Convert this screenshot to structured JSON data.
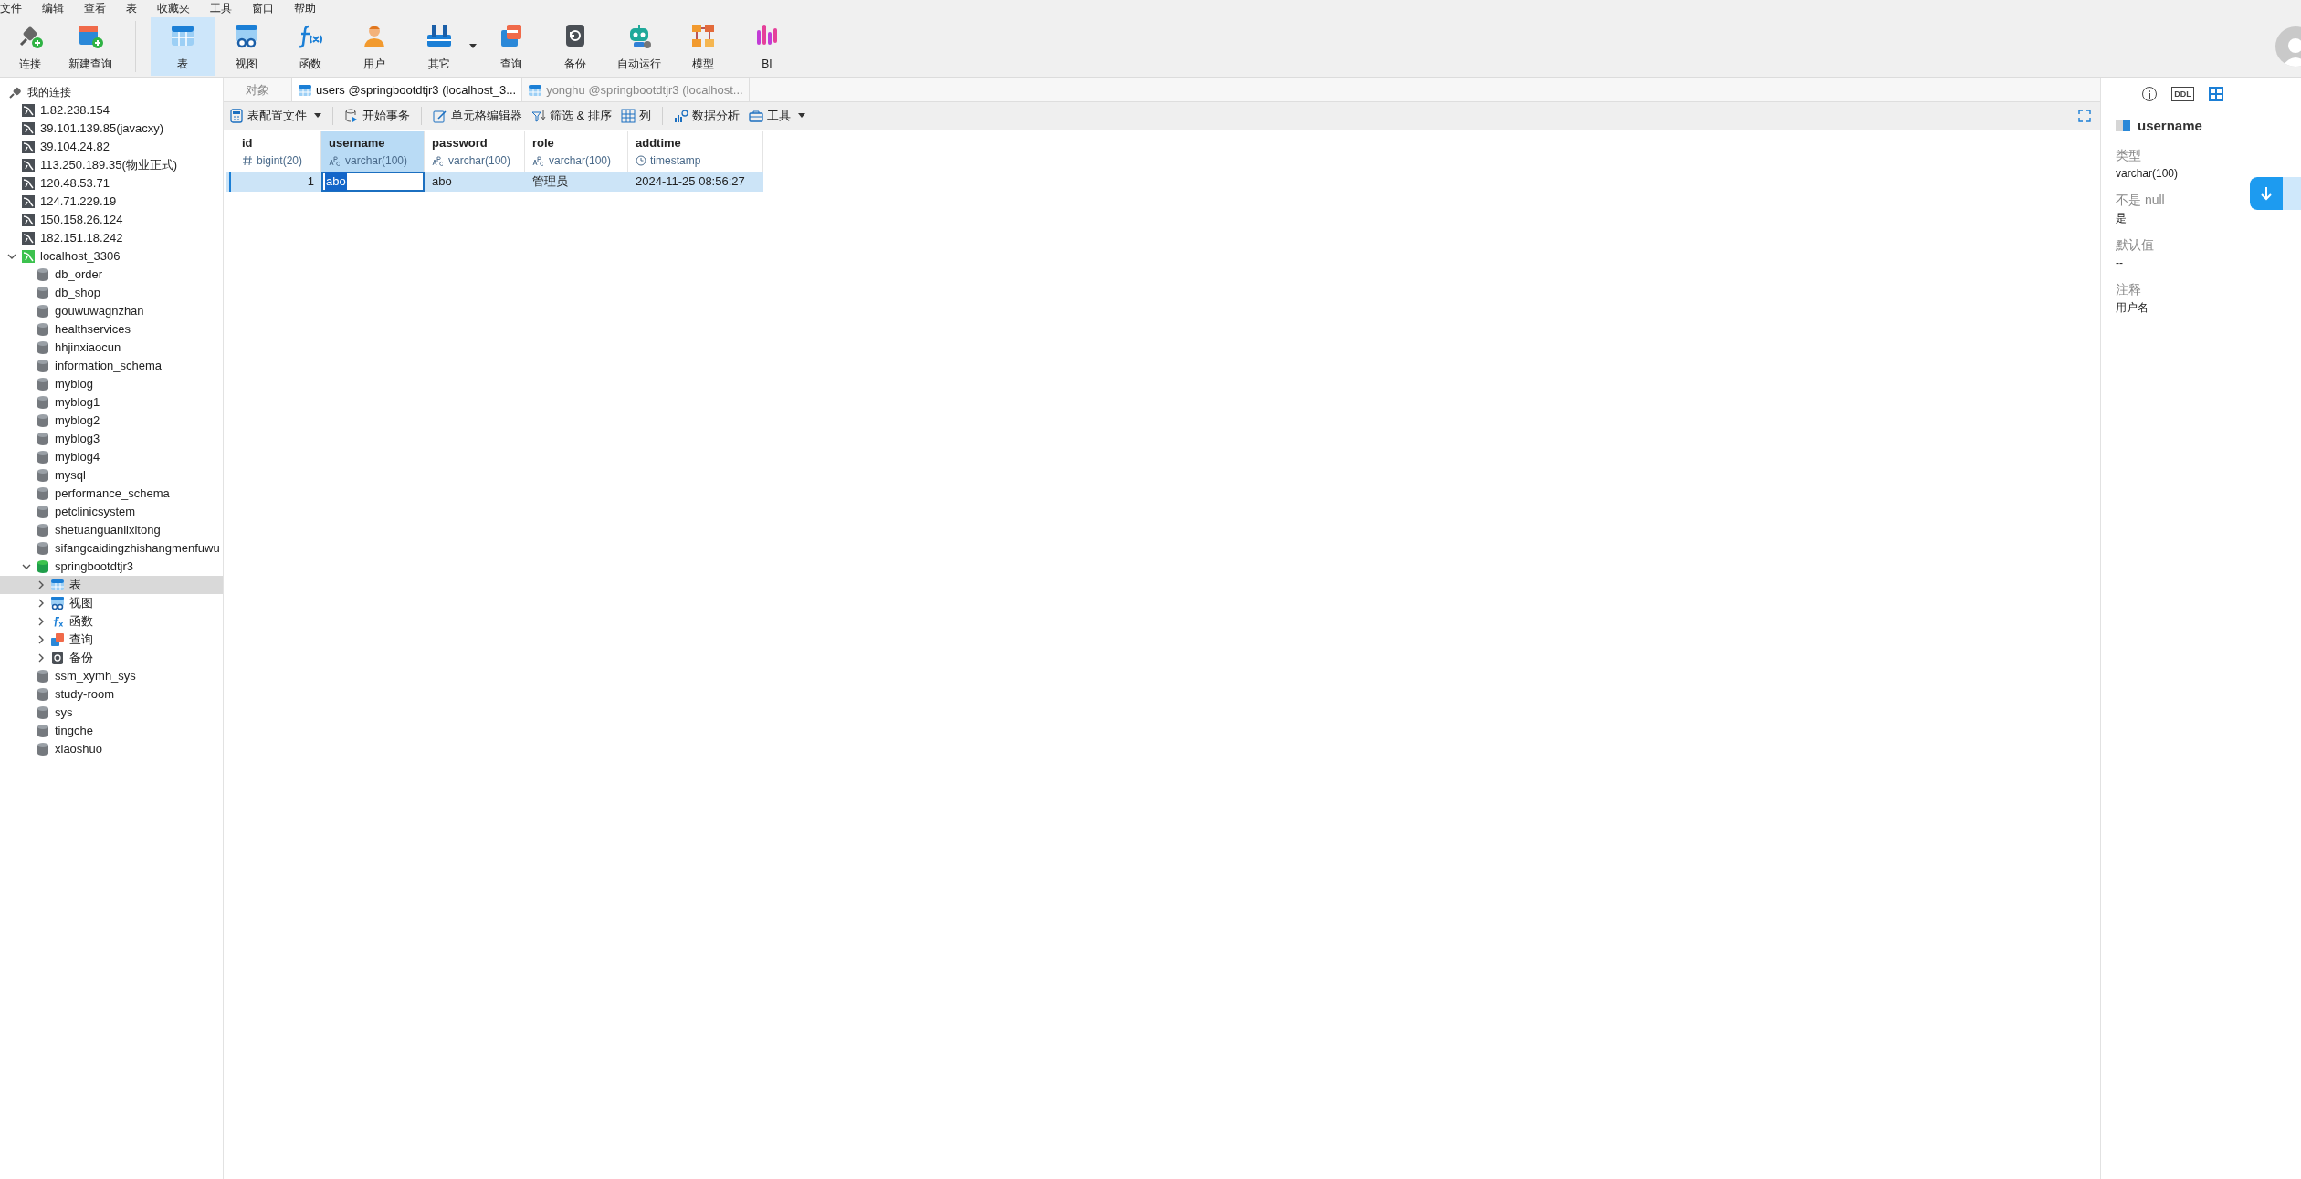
{
  "menu": [
    "文件",
    "编辑",
    "查看",
    "表",
    "收藏夹",
    "工具",
    "窗口",
    "帮助"
  ],
  "toolbar": [
    {
      "label": "连接",
      "kind": "connect",
      "selected": false,
      "dropdown": false
    },
    {
      "label": "新建查询",
      "kind": "newquery",
      "selected": false,
      "dropdown": false
    },
    {
      "label": "表",
      "kind": "table",
      "selected": true,
      "dropdown": false
    },
    {
      "label": "视图",
      "kind": "view",
      "selected": false,
      "dropdown": false
    },
    {
      "label": "函数",
      "kind": "function",
      "selected": false,
      "dropdown": false
    },
    {
      "label": "用户",
      "kind": "user",
      "selected": false,
      "dropdown": false
    },
    {
      "label": "其它",
      "kind": "other",
      "selected": false,
      "dropdown": true
    },
    {
      "label": "查询",
      "kind": "query",
      "selected": false,
      "dropdown": false
    },
    {
      "label": "备份",
      "kind": "backup",
      "selected": false,
      "dropdown": false
    },
    {
      "label": "自动运行",
      "kind": "robot",
      "selected": false,
      "dropdown": false
    },
    {
      "label": "模型",
      "kind": "model",
      "selected": false,
      "dropdown": false
    },
    {
      "label": "BI",
      "kind": "bi",
      "selected": false,
      "dropdown": false
    }
  ],
  "sidebar": {
    "title": "我的连接",
    "items": [
      {
        "label": "1.82.238.154",
        "kind": "connection"
      },
      {
        "label": "39.101.139.85(javacxy)",
        "kind": "connection"
      },
      {
        "label": "39.104.24.82",
        "kind": "connection"
      },
      {
        "label": "113.250.189.35(物业正式)",
        "kind": "connection"
      },
      {
        "label": "120.48.53.71",
        "kind": "connection"
      },
      {
        "label": "124.71.229.19",
        "kind": "connection"
      },
      {
        "label": "150.158.26.124",
        "kind": "connection"
      },
      {
        "label": "182.151.18.242",
        "kind": "connection"
      },
      {
        "label": "localhost_3306",
        "kind": "connection",
        "expanded": true,
        "children": [
          {
            "label": "db_order",
            "kind": "database"
          },
          {
            "label": "db_shop",
            "kind": "database"
          },
          {
            "label": "gouwuwagnzhan",
            "kind": "database"
          },
          {
            "label": "healthservices",
            "kind": "database"
          },
          {
            "label": "hhjinxiaocun",
            "kind": "database"
          },
          {
            "label": "information_schema",
            "kind": "database"
          },
          {
            "label": "myblog",
            "kind": "database"
          },
          {
            "label": "myblog1",
            "kind": "database"
          },
          {
            "label": "myblog2",
            "kind": "database"
          },
          {
            "label": "myblog3",
            "kind": "database"
          },
          {
            "label": "myblog4",
            "kind": "database"
          },
          {
            "label": "mysql",
            "kind": "database"
          },
          {
            "label": "performance_schema",
            "kind": "database"
          },
          {
            "label": "petclinicsystem",
            "kind": "database"
          },
          {
            "label": "shetuanguanlixitong",
            "kind": "database"
          },
          {
            "label": "sifangcaidingzhishangmenfuwu",
            "kind": "database"
          },
          {
            "label": "springbootdtjr3",
            "kind": "database",
            "expanded": true,
            "children": [
              {
                "label": "表",
                "kind": "table",
                "expanded": false,
                "selected": true
              },
              {
                "label": "视图",
                "kind": "view",
                "expanded": false,
                "selected": false
              },
              {
                "label": "函数",
                "kind": "function",
                "expanded": false,
                "selected": false
              },
              {
                "label": "查询",
                "kind": "query",
                "expanded": false,
                "selected": false
              },
              {
                "label": "备份",
                "kind": "backup",
                "expanded": false,
                "selected": false
              }
            ]
          },
          {
            "label": "ssm_xymh_sys",
            "kind": "database"
          },
          {
            "label": "study-room",
            "kind": "database"
          },
          {
            "label": "sys",
            "kind": "database"
          },
          {
            "label": "tingche",
            "kind": "database"
          },
          {
            "label": "xiaoshuo",
            "kind": "database"
          }
        ]
      }
    ]
  },
  "tabs": [
    {
      "label": "对象",
      "kind": "objects",
      "selected": false
    },
    {
      "label": "users @springbootdtjr3 (localhost_3...",
      "kind": "table",
      "selected": true
    },
    {
      "label": "yonghu @springbootdtjr3 (localhost...",
      "kind": "table",
      "selected": false
    }
  ],
  "subtoolbar": [
    {
      "label": "表配置文件",
      "kind": "profile",
      "dropdown": true
    },
    {
      "label": "开始事务",
      "kind": "transaction",
      "dropdown": false
    },
    {
      "label": "单元格编辑器",
      "kind": "editor",
      "dropdown": false
    },
    {
      "label": "筛选 & 排序",
      "kind": "filter",
      "dropdown": false
    },
    {
      "label": "列",
      "kind": "columns",
      "dropdown": false
    },
    {
      "label": "数据分析",
      "kind": "analysis",
      "dropdown": false
    },
    {
      "label": "工具",
      "kind": "tools",
      "dropdown": true
    }
  ],
  "table": {
    "columns": [
      {
        "name": "id",
        "type": "bigint(20)",
        "kind": "number",
        "selected": false
      },
      {
        "name": "username",
        "type": "varchar(100)",
        "kind": "text",
        "selected": true
      },
      {
        "name": "password",
        "type": "varchar(100)",
        "kind": "text",
        "selected": false
      },
      {
        "name": "role",
        "type": "varchar(100)",
        "kind": "text",
        "selected": false
      },
      {
        "name": "addtime",
        "type": "timestamp",
        "kind": "time",
        "selected": false
      }
    ],
    "rows": [
      {
        "selected": true,
        "cells": [
          {
            "value": "1",
            "editing": false
          },
          {
            "value": "abo",
            "editing": true
          },
          {
            "value": "abo",
            "editing": false
          },
          {
            "value": "管理员",
            "editing": false
          },
          {
            "value": "2024-11-25 08:56:27",
            "editing": false
          }
        ]
      }
    ]
  },
  "inspector": {
    "views": [
      {
        "kind": "info",
        "selected": false
      },
      {
        "kind": "ddl",
        "label": "DDL",
        "selected": false
      },
      {
        "kind": "fields",
        "selected": true
      }
    ],
    "field": "username",
    "properties": [
      {
        "label": "类型",
        "value": "varchar(100)"
      },
      {
        "label": "不是 null",
        "value": "是"
      },
      {
        "label": "默认值",
        "value": "--"
      },
      {
        "label": "注释",
        "value": "用户名"
      }
    ]
  }
}
